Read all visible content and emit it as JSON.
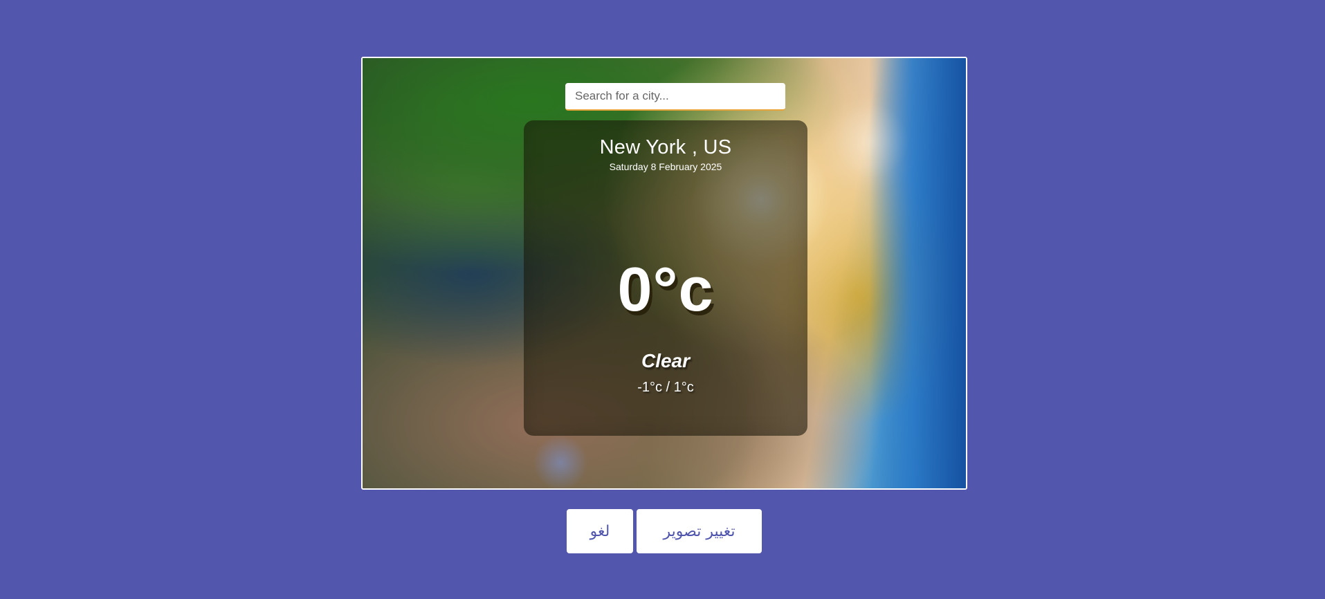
{
  "search": {
    "placeholder": "Search for a city...",
    "value": ""
  },
  "weather": {
    "location": "New York , US",
    "date": "Saturday 8 February 2025",
    "temperature": "0°c",
    "condition": "Clear",
    "min_max": "-1°c / 1°c"
  },
  "buttons": {
    "cancel_label": "لغو",
    "change_image_label": "تغییر تصویر"
  },
  "colors": {
    "page_background": "#5256ac",
    "button_text": "#4f54ad",
    "search_underline": "#e8a33a"
  }
}
